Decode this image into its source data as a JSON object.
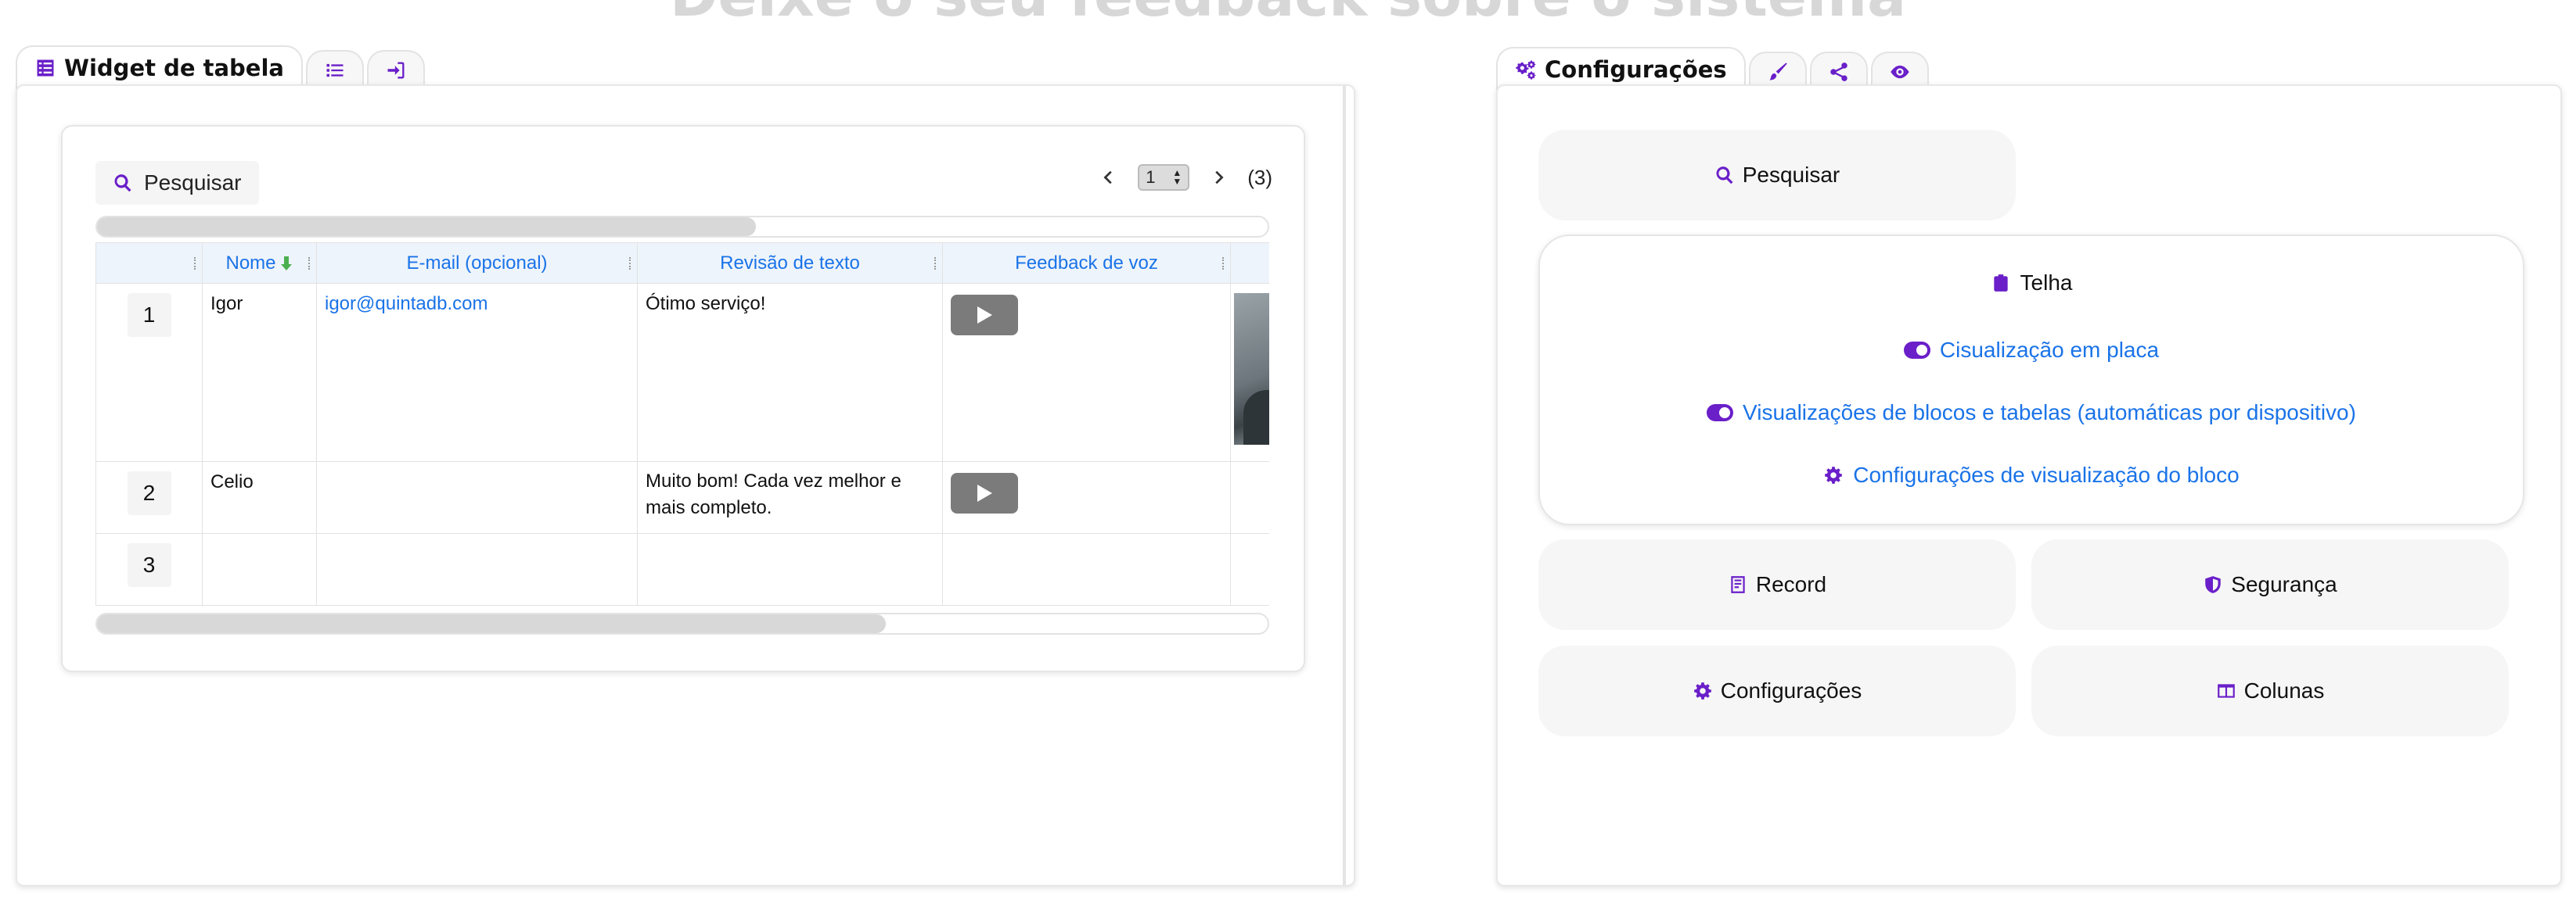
{
  "page": {
    "title": "Deixe o seu feedback sobre o sistema"
  },
  "left_tabs": {
    "active_label": "Widget de tabela",
    "active_icon": "table-list-icon",
    "tab2_icon": "list-icon",
    "tab3_icon": "sign-in-icon"
  },
  "table_widget": {
    "search_label": "Pesquisar",
    "pager": {
      "current_page": "1",
      "total": "(3)"
    },
    "columns": [
      "Nome",
      "E-mail (opcional)",
      "Revisão de texto",
      "Feedback de voz"
    ],
    "rows": [
      {
        "num": "1",
        "nome": "Igor",
        "email": "igor@quintadb.com",
        "revisao": "Ótimo serviço!",
        "has_voice": true
      },
      {
        "num": "2",
        "nome": "Celio",
        "email": "",
        "revisao": "Muito bom! Cada vez melhor e mais completo.",
        "has_voice": true
      },
      {
        "num": "3",
        "nome": "",
        "email": "",
        "revisao": "",
        "has_voice": false
      }
    ],
    "scroll": {
      "top_fraction": 0.56,
      "bottom_fraction": 0.67
    }
  },
  "right_tabs": {
    "active_label": "Configurações",
    "active_icon": "cogs-icon",
    "tab2_icon": "brush-icon",
    "tab3_icon": "share-icon",
    "tab4_icon": "eye-icon"
  },
  "settings": {
    "search_label": "Pesquisar",
    "telha": {
      "title": "Telha",
      "option1": "Cisualização em placa",
      "option2": "Visualizações de blocos e tabelas (automáticas por dispositivo)",
      "option3": "Configurações de visualização do bloco"
    },
    "record_label": "Record",
    "seguranca_label": "Segurança",
    "configuracoes_label": "Configurações",
    "colunas_label": "Colunas"
  },
  "colors": {
    "accent": "#6a1fc9",
    "link": "#1a73e8",
    "sort": "#4caf50"
  }
}
